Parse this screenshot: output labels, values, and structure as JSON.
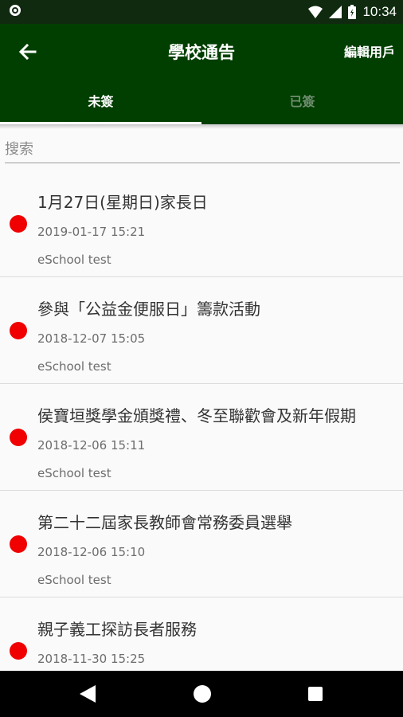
{
  "status_bar": {
    "time": "10:34"
  },
  "app_bar": {
    "title": "學校通告",
    "edit_user_label": "編輯用戶"
  },
  "tabs": [
    {
      "label": "未簽",
      "selected": true
    },
    {
      "label": "已簽",
      "selected": false
    }
  ],
  "search": {
    "placeholder": "搜索",
    "value": ""
  },
  "notices": [
    {
      "title": "1月27日(星期日)家長日",
      "date": "2019-01-17 15:21",
      "author": "eSchool test"
    },
    {
      "title": "參與「公益金便服日」籌款活動",
      "date": "2018-12-07 15:05",
      "author": "eSchool test"
    },
    {
      "title": "侯寶垣獎學金頒獎禮、冬至聯歡會及新年假期",
      "date": "2018-12-06 15:11",
      "author": "eSchool test"
    },
    {
      "title": "第二十二屆家長教師會常務委員選舉",
      "date": "2018-12-06 15:10",
      "author": "eSchool test"
    },
    {
      "title": "親子義工探訪長者服務",
      "date": "2018-11-30 15:25",
      "author": ""
    }
  ],
  "colors": {
    "toolbar": "#003f00",
    "status_bar": "#0f2a0f",
    "unread_dot": "#f00000"
  }
}
